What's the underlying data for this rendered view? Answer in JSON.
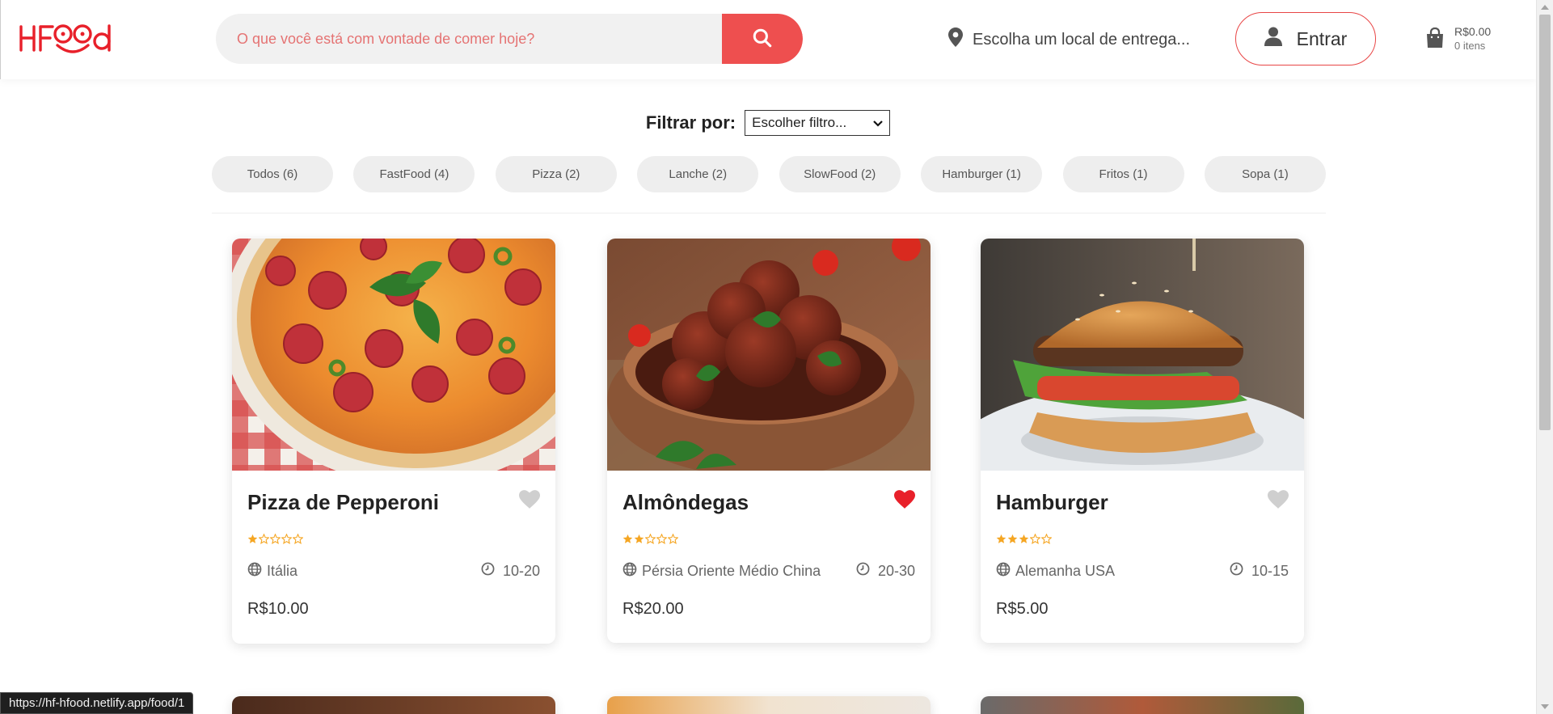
{
  "brand": {
    "logo_text": "HFood",
    "accent": "#ee4f4f"
  },
  "header": {
    "search_placeholder": "O que você está com vontade de comer hoje?",
    "location_text": "Escolha um local de entrega...",
    "login_label": "Entrar",
    "cart_total": "R$0.00",
    "cart_items": "0 itens"
  },
  "filter": {
    "label": "Filtrar por:",
    "selected": "Escolher filtro...",
    "chips": [
      "Todos (6)",
      "FastFood (4)",
      "Pizza (2)",
      "Lanche (2)",
      "SlowFood (2)",
      "Hamburger (1)",
      "Fritos (1)",
      "Sopa (1)"
    ]
  },
  "foods": [
    {
      "name": "Pizza de Pepperoni",
      "favorite": false,
      "rating": 1,
      "origin": "Itália",
      "time": "10-20",
      "price": "R$10.00"
    },
    {
      "name": "Almôndegas",
      "favorite": true,
      "rating": 2,
      "origin": "Pérsia Oriente Médio China",
      "time": "20-30",
      "price": "R$20.00"
    },
    {
      "name": "Hamburger",
      "favorite": false,
      "rating": 3,
      "origin": "Alemanha USA",
      "time": "10-15",
      "price": "R$5.00"
    }
  ],
  "status_url": "https://hf-hfood.netlify.app/food/1",
  "colors": {
    "heart_active": "#e8202a",
    "heart_inactive": "#cfcfcf",
    "star": "#f5a623"
  },
  "icons": {
    "search": "search-icon",
    "location": "map-pin-icon",
    "user": "user-icon",
    "cart": "shopping-bag-icon",
    "heart": "heart-icon",
    "star": "star-icon",
    "globe": "globe-icon",
    "clock": "clock-icon"
  }
}
